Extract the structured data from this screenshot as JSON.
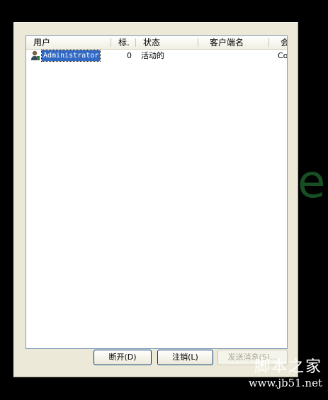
{
  "background": {
    "color": "#000000",
    "glow_text": "e"
  },
  "list": {
    "columns": [
      "用户",
      "标.",
      "状态",
      "客户端名",
      "会"
    ],
    "rows": [
      {
        "user": "Administrator",
        "id": "0",
        "status": "活动的",
        "client": "",
        "session": "Co"
      }
    ]
  },
  "buttons": {
    "disconnect": "断开(D)",
    "logoff": "注销(L)",
    "send_message": "发送消息(S)..."
  },
  "watermark": {
    "line1": "脚本之家",
    "line2": "www.jb51.net"
  },
  "colors": {
    "selection": "#316ac5",
    "list_border": "#7f9db9",
    "panel": "#ece9d8"
  }
}
